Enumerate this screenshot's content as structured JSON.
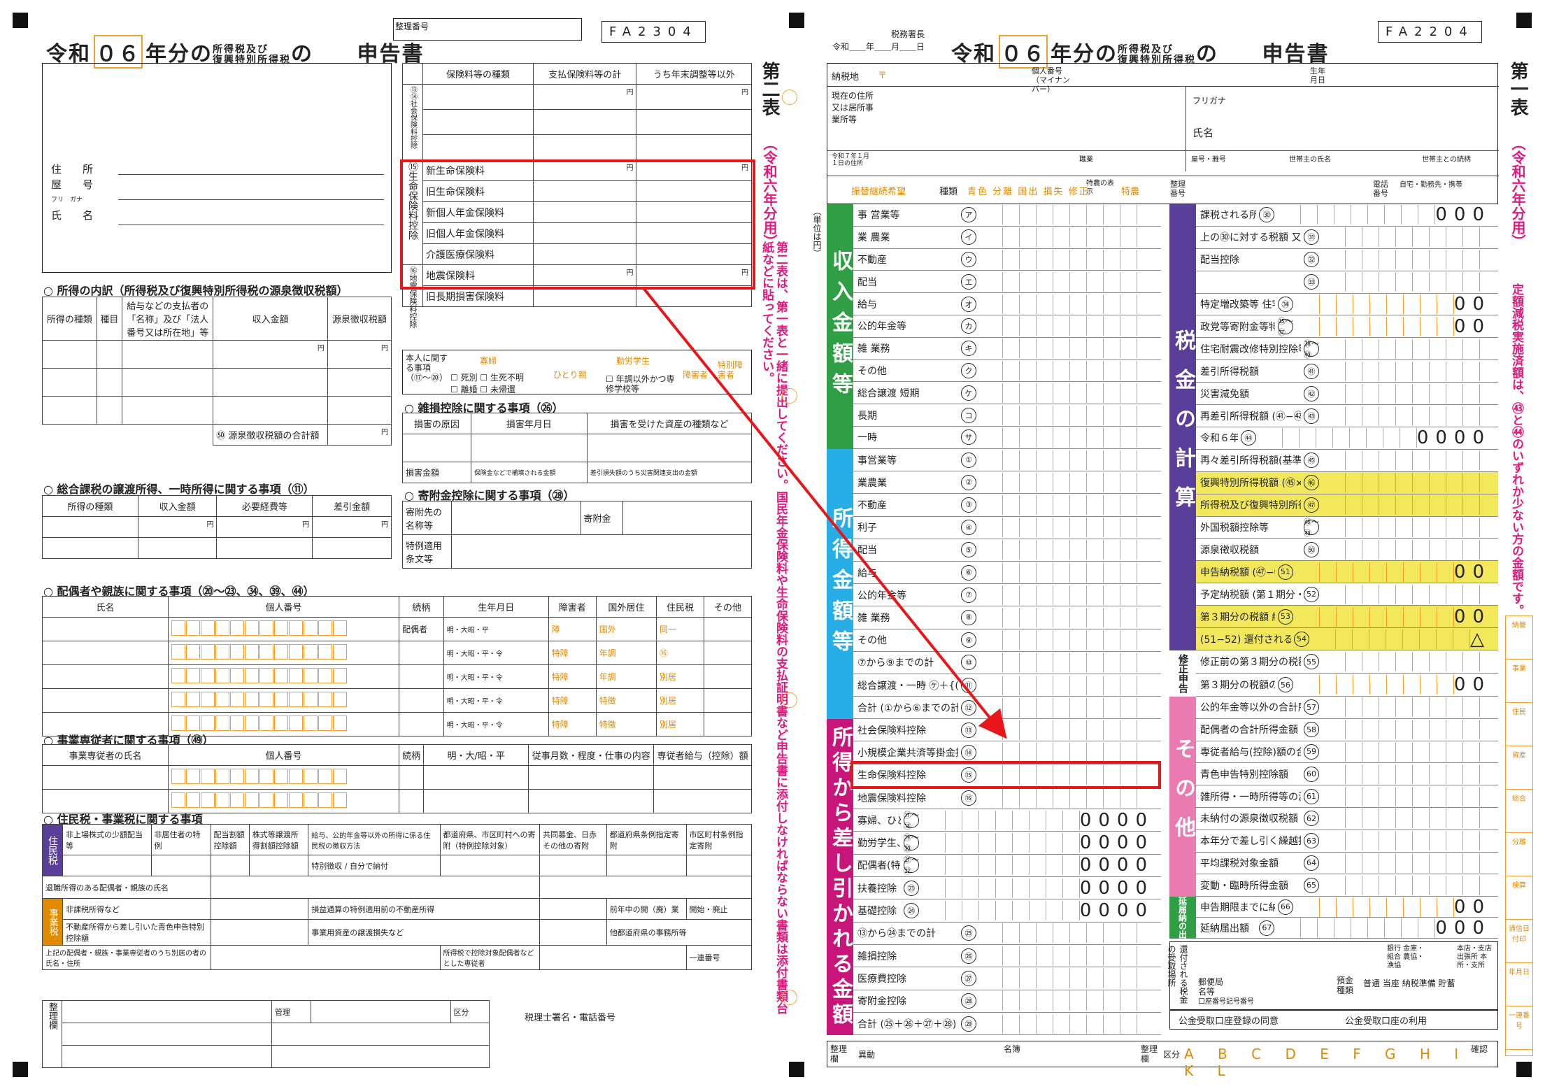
{
  "left_form": {
    "title_prefix": "令和",
    "year": "０６",
    "title_mid": "年分の",
    "title_tax_1": "所得税及び",
    "title_tax_2": "復興特別所得税",
    "title_no": "の",
    "title_main": "申告書",
    "seiri": "整理番号",
    "code": "FA2304",
    "side_label": "第二表",
    "side_note": "（令和六年分用）",
    "side_long": "第二表は、第一表と一緒に提出してください。国民年金保険料や生命保険料の支払証明書など申告書に添付しなければならない書類は添付書類台紙などに貼ってください。",
    "address": {
      "jusho": "住　　所",
      "yago": "屋　　号",
      "furigana": "フリ　ガナ",
      "shimei": "氏　　名"
    },
    "insurance_header": [
      "保険料等の種類",
      "支払保険料等の計",
      "うち年末調整等以外"
    ],
    "social_insurance_label": "⑬⑭社会保険料控除",
    "life_insurance_label": "⑮生命保険料控除",
    "life_rows": [
      "新生命保険料",
      "旧生命保険料",
      "新個人年金保険料",
      "旧個人年金保険料",
      "介護医療保険料"
    ],
    "quake_label": "⑯地震保険料控除",
    "quake_rows": [
      "地震保険料",
      "旧長期損害保険料"
    ],
    "yen": "円",
    "personal": {
      "head": "本人に関する事項（⑰〜⑳）",
      "widow": "寡婦",
      "single": "ひとり親",
      "student": "勤労学生",
      "disabled": "障害者",
      "special": "特別障害者",
      "opts": [
        "死別",
        "生死不明",
        "離婚",
        "未帰還",
        "年調以外かつ専修学校等"
      ]
    },
    "income_breakdown": {
      "title": "所得の内訳（所得税及び復興特別所得税の源泉徴収税額）",
      "headers": [
        "所得の種類",
        "種目",
        "給与などの支払者の「名称」及び「法人番号又は所在地」等",
        "収入金額",
        "源泉徴収税額"
      ],
      "total": "㊿ 源泉徴収税額の合計額"
    },
    "casualty": {
      "title": "雑損控除に関する事項（㉖）",
      "headers": [
        "損害の原因",
        "損害年月日",
        "損害を受けた資産の種類など"
      ],
      "amount": "損害金額",
      "insurance": "保険金などで補填される金額",
      "deduct": "差引損失額のうち災害関連支出の金額"
    },
    "donation": {
      "title": "寄附金控除に関する事項（㉘）",
      "dest": "寄附先の名称等",
      "amt": "寄附金",
      "special": "特例適用条文等"
    },
    "capital_gains": {
      "title": "総合課税の譲渡所得、一時所得に関する事項（⑪）",
      "headers": [
        "所得の種類",
        "収入金額",
        "必要経費等",
        "差引金額"
      ]
    },
    "dependents": {
      "title": "配偶者や親族に関する事項（⑳〜㉓、㉞、㊴、㊹）",
      "headers": [
        "氏名",
        "個人番号",
        "続柄",
        "生年月日",
        "障害者",
        "国外居住",
        "住民税",
        "その他"
      ],
      "spouse": "配偶者",
      "era": [
        "明・大昭・平",
        "明・大昭・平・令",
        "明・大昭・平・令",
        "明・大昭・平・令",
        "明・大昭・平・令"
      ],
      "tags": [
        "障",
        "特障",
        "国外",
        "年調",
        "特徴",
        "同一",
        "別居",
        "⑯"
      ]
    },
    "family_employees": {
      "title": "事業専従者に関する事項（㊾）",
      "headers": [
        "事業専従者の氏名",
        "個人番号",
        "続柄",
        "生年月日",
        "従事月数・程度・仕事の内容",
        "専従者給与（控除）額"
      ]
    },
    "resident_tax": {
      "title": "住民税・事業税に関する事項",
      "band": "住民税",
      "band2": "事業税",
      "headers": [
        "非上場株式の少額配当等",
        "非居住者の特例",
        "配当割額控除額",
        "株式等譲渡所得割額控除額",
        "給与、公的年金等以外の所得に係る住民税の徴収方法",
        "都道府県、市区町村への寄附（特例控除対象）",
        "共同募金、日赤その他の寄附",
        "都道府県条例指定寄附",
        "市区町村条例指定寄附"
      ],
      "collect": [
        "特別徴収",
        "自分で納付"
      ],
      "retire": "退職所得のある配偶者・親族の氏名",
      "biz_items": [
        "非課税所得など",
        "不動産所得から差し引いた青色申告特別控除額",
        "損益通算の特例適用前の不動産所得",
        "事業用資産の譲渡損失など",
        "前年中の開（廃）業",
        "開始・廃止",
        "他都道府県の事務所等"
      ],
      "dependent_note": "上記の配偶者・親族・事業専従者のうち別居の者の氏名・住所",
      "kokugai": "国外",
      "shotoku_kojo": "所得税で控除対象配偶者などとした専従者"
    },
    "office": {
      "seiri": "整理欄",
      "kanri": "管理",
      "ku": "区分",
      "zeirishi": "税理士署名・電話番号",
      "ittsu": "一連番号"
    }
  },
  "right_form": {
    "taxoffice": "税務署長",
    "date_line": "令和＿＿年＿＿月＿＿日",
    "title_prefix": "令和",
    "year": "０６",
    "title_mid": "年分の",
    "title_tax_1": "所得税及び",
    "title_tax_2": "復興特別所得税",
    "title_no": "の",
    "title_main": "申告書",
    "code": "FA2204",
    "side_label": "第一表",
    "side_note": "（令和六年分用）",
    "side_long": "定額減税実施済額は、㊸と㊹のいずれか少ない方の金額です。",
    "header": {
      "zip": "〒",
      "nozeichi": "納税地",
      "mynumber": "個人番号（マイナンバー）",
      "birth": "生年月日",
      "current": "現在の住所又は居所事業所等",
      "furigana": "フリガナ",
      "name": "氏名",
      "jan1": "令和７年１月１日の住所",
      "job": "職業",
      "yago": "屋号・雅号",
      "householder": "世帯主の氏名",
      "relation": "世帯主との続柄",
      "phone": "電話番号",
      "phone_kind": "自宅・勤務先・携帯",
      "furikae": "振替継続希望",
      "kind": "種類",
      "kinds": [
        "青色",
        "分離",
        "国出",
        "損失",
        "修正"
      ],
      "tokuno": "特農の表示",
      "tokuno_val": "特農",
      "seiri": "整理番号"
    },
    "unit": "（単位は円）",
    "income_band": "収入金額等",
    "income_rows": [
      {
        "g": "事",
        "label": "営業等",
        "k": "区分",
        "n": "ア"
      },
      {
        "g": "業",
        "label": "農業",
        "k": "区分",
        "n": "イ"
      },
      {
        "g": "",
        "label": "不動産",
        "k": "区分1 区分2",
        "n": "ウ"
      },
      {
        "g": "",
        "label": "配当",
        "k": "",
        "n": "エ"
      },
      {
        "g": "",
        "label": "給与",
        "k": "区分",
        "n": "オ"
      },
      {
        "g": "",
        "label": "公的年金等",
        "k": "",
        "n": "カ"
      },
      {
        "g": "雑",
        "label": "業務",
        "k": "区分",
        "n": "キ"
      },
      {
        "g": "",
        "label": "その他",
        "k": "区分",
        "n": "ク"
      },
      {
        "g": "総合譲渡",
        "label": "短期",
        "k": "",
        "n": "ケ"
      },
      {
        "g": "",
        "label": "長期",
        "k": "",
        "n": "コ"
      },
      {
        "g": "",
        "label": "一時",
        "k": "",
        "n": "サ"
      }
    ],
    "shotoku_band": "所得金額等",
    "shotoku_rows": [
      {
        "label": "事営業等",
        "n": "①"
      },
      {
        "label": "業農業",
        "n": "②"
      },
      {
        "label": "不動産",
        "n": "③"
      },
      {
        "label": "利子",
        "n": "④"
      },
      {
        "label": "配当",
        "n": "⑤"
      },
      {
        "label": "給与",
        "n": "⑥"
      },
      {
        "label": "公的年金等",
        "n": "⑦"
      },
      {
        "label": "雑 業務",
        "n": "⑧"
      },
      {
        "label": "その他",
        "n": "⑨"
      },
      {
        "label": "⑦から⑨までの計",
        "n": "⑩"
      },
      {
        "label": "総合譲渡・一時 ㋘＋{(㋙＋㋚)×½}",
        "n": "⑪"
      },
      {
        "label": "合計 (①から⑥までの計＋⑩＋⑪)",
        "n": "⑫"
      }
    ],
    "deduct_band": "所得から差し引かれる金額",
    "deduct_rows": [
      {
        "label": "社会保険料控除",
        "n": "⑬",
        "z": ""
      },
      {
        "label": "小規模企業共済等掛金控除",
        "n": "⑭",
        "z": ""
      },
      {
        "label": "生命保険料控除",
        "n": "⑮",
        "z": ""
      },
      {
        "label": "地震保険料控除",
        "n": "⑯",
        "z": ""
      },
      {
        "label": "寡婦、ひとり親控除",
        "n": "⑰〜⑱",
        "z": "0000"
      },
      {
        "label": "勤労学生、障害者控除",
        "n": "⑲〜⑳",
        "z": "0000"
      },
      {
        "label": "配偶者(特別)控除",
        "n": "㉑〜㉒",
        "z": "0000"
      },
      {
        "label": "扶養控除",
        "n": "㉓",
        "z": "0000"
      },
      {
        "label": "基礎控除",
        "n": "㉔",
        "z": "0000"
      },
      {
        "label": "⑬から㉔までの計",
        "n": "㉕",
        "z": ""
      },
      {
        "label": "雑損控除",
        "n": "㉖",
        "z": ""
      },
      {
        "label": "医療費控除",
        "n": "㉗",
        "z": ""
      },
      {
        "label": "寄附金控除",
        "n": "㉘",
        "z": ""
      },
      {
        "label": "合計 (㉕＋㉖＋㉗＋㉘)",
        "n": "㉙",
        "z": ""
      }
    ],
    "tax_band": "税金の計算",
    "tax_rows": [
      {
        "label": "課税される所得金額 (⑫−㉙)又は第三表",
        "n": "㉚",
        "z": "000"
      },
      {
        "label": "上の㉚に対する税額 又は第三表の㊻",
        "n": "㉛",
        "z": ""
      },
      {
        "label": "配当控除",
        "n": "㉜",
        "z": ""
      },
      {
        "label": "",
        "n": "㉝",
        "z": ""
      },
      {
        "label": "特定増改築等 住宅借入金等特別控除",
        "n": "㉞",
        "z": "00"
      },
      {
        "label": "政党等寄附金等特別控除",
        "n": "㉟〜㊲",
        "z": "00"
      },
      {
        "label": "住宅耐震改修特別控除等",
        "n": "㊳〜㊵",
        "z": ""
      },
      {
        "label": "差引所得税額",
        "n": "㊶",
        "z": ""
      },
      {
        "label": "災害減免額",
        "n": "㊷",
        "z": ""
      },
      {
        "label": "再差引所得税額 (㊶−㊷)",
        "n": "㊸",
        "z": ""
      },
      {
        "label": "令和６年分特別税額控除",
        "n": "㊹",
        "z": "0000"
      },
      {
        "label": "再々差引所得税額(基準所得税額)",
        "n": "㊺",
        "z": ""
      },
      {
        "label": "復興特別所得税額 (㊺×2.1%)",
        "n": "㊻",
        "z": ""
      },
      {
        "label": "所得税及び復興特別所得税の額 (㊺＋㊻)",
        "n": "㊼",
        "z": ""
      },
      {
        "label": "外国税額控除等",
        "n": "㊽〜㊾",
        "z": ""
      },
      {
        "label": "源泉徴収税額",
        "n": "㊿",
        "z": ""
      },
      {
        "label": "申告納税額 (㊼−㊽−㊾−㊿)",
        "n": "51",
        "z": "00"
      },
      {
        "label": "予定納税額 (第１期分・第２期分)",
        "n": "52",
        "z": ""
      },
      {
        "label": "第３期分の税額 納める税金",
        "n": "53",
        "z": "00"
      },
      {
        "label": "(51−52) 還付される税金",
        "n": "54",
        "z": "△"
      }
    ],
    "shusei_band": "修正申告",
    "shusei_rows": [
      {
        "label": "修正前の第３期分の税額",
        "n": "55",
        "z": ""
      },
      {
        "label": "第３期分の税額の増加額",
        "n": "56",
        "z": "00"
      }
    ],
    "other_band": "その他",
    "other_rows": [
      {
        "label": "公的年金等以外の合計所得金額",
        "n": "57"
      },
      {
        "label": "配偶者の合計所得金額",
        "n": "58"
      },
      {
        "label": "専従者給与(控除)額の合計額",
        "n": "59"
      },
      {
        "label": "青色申告特別控除額",
        "n": "60"
      },
      {
        "label": "雑所得・一時所得等の源泉徴収税額の合計額",
        "n": "61"
      },
      {
        "label": "未納付の源泉徴収税額",
        "n": "62"
      },
      {
        "label": "本年分で差し引く繰越損失額",
        "n": "63"
      },
      {
        "label": "平均課税対象金額",
        "n": "64"
      },
      {
        "label": "変動・臨時所得金額",
        "n": "65"
      }
    ],
    "enno_band": "延届納の出",
    "enno_rows": [
      {
        "label": "申告期限までに納付する金額",
        "n": "66",
        "z": "00"
      },
      {
        "label": "延納届出額",
        "n": "67",
        "z": "000"
      }
    ],
    "refund": {
      "band": "還付される税金の受取場所",
      "bank": "銀行 金庫・組合 農協・漁協",
      "branch": "本店・支店 出張所 本所・支所",
      "post": "郵便局名等",
      "deposit": "預金種類",
      "kinds": [
        "普通",
        "当座",
        "納税準備",
        "貯蓄"
      ],
      "account": "口座番号記号番号",
      "agree": "公金受取口座登録の同意",
      "use": "公金受取口座の利用"
    },
    "footer": {
      "seiri": "整理欄",
      "ido": "異動",
      "meibo": "名簿",
      "ku": "区分",
      "letters": [
        "A",
        "B",
        "C",
        "D",
        "E",
        "F",
        "G",
        "H",
        "I",
        "K",
        "L"
      ],
      "kakunin": "確認"
    },
    "bottom_side": [
      "納管",
      "事業",
      "住民",
      "資産",
      "総合",
      "分離",
      "検算",
      "通信日付印",
      "年月日",
      "一連番号"
    ]
  },
  "colors": {
    "highlight": "#e8161b",
    "income_band": "#2f9e45",
    "shotoku_band": "#28aee6",
    "deduct_band": "#c8157a",
    "tax_band": "#5a3f9a",
    "other_band": "#e97bb1",
    "yellow": "#f3e85c",
    "orange": "#f0a030"
  }
}
